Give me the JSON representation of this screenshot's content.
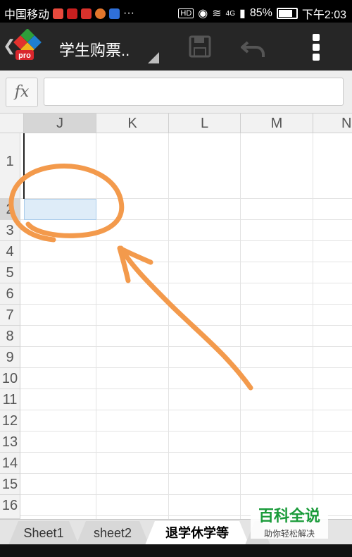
{
  "status_bar": {
    "carrier": "中国移动",
    "dots": "···",
    "hd": "HD",
    "network": "4G",
    "battery": "85%",
    "time": "下午2:03"
  },
  "toolbar": {
    "back_icon": "chevron-left-icon",
    "logo_badge": "pro",
    "title": "学生购票..",
    "icons": [
      "save-icon",
      "undo-icon",
      "more-vert-icon"
    ]
  },
  "formula_bar": {
    "fx_label": "fx",
    "value": ""
  },
  "grid": {
    "columns": [
      "J",
      "K",
      "L",
      "M",
      "N"
    ],
    "selected_column": "J",
    "rows": [
      "1",
      "2",
      "3",
      "4",
      "5",
      "6",
      "7",
      "8",
      "9",
      "10",
      "11",
      "12",
      "13",
      "14",
      "15",
      "16"
    ],
    "selected_row": "2",
    "selected_cell": "J2",
    "selection_color": "#deecf8"
  },
  "sheets": {
    "tabs": [
      "Sheet1",
      "sheet2",
      "退学休学等"
    ],
    "active": "退学休学等"
  },
  "watermark": {
    "title": "百科全说",
    "subtitle": "助你轻松解决"
  },
  "annotation": {
    "color": "#f39a4c",
    "shapes": [
      "circle",
      "arrow"
    ]
  }
}
